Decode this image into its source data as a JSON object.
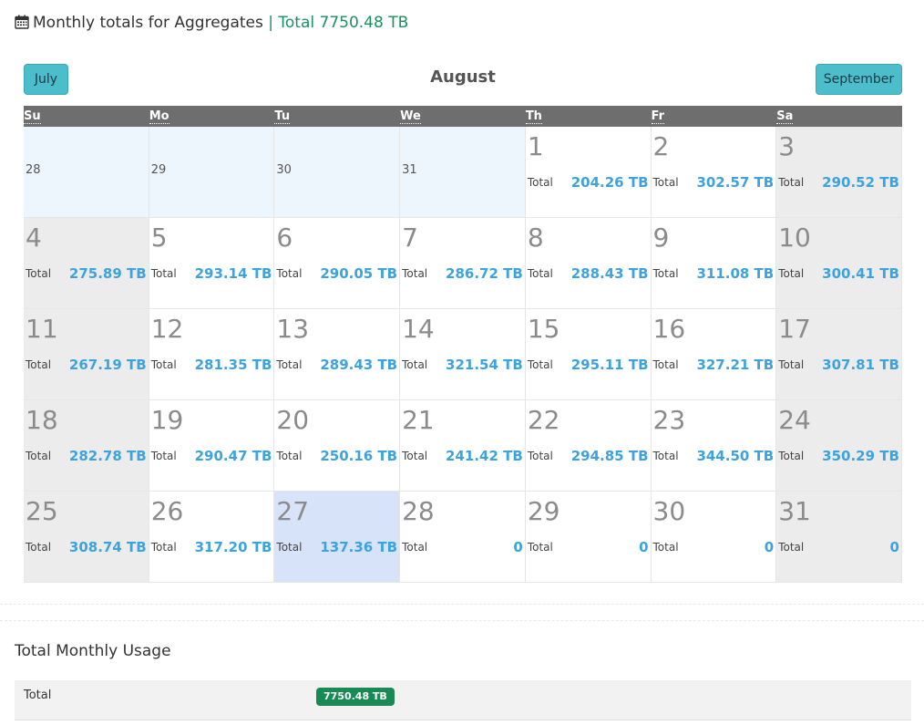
{
  "header": {
    "icon": "calendar-icon",
    "title": "Monthly totals for Aggregates",
    "separator": "|",
    "total_text": "Total 7750.48 TB",
    "accent_color": "#1a9160"
  },
  "nav": {
    "prev_label": "July",
    "month_label": "August",
    "next_label": "September",
    "button_color": "#4bbdcb"
  },
  "calendar": {
    "weekdays": [
      "Su",
      "Mo",
      "Tu",
      "We",
      "Th",
      "Fr",
      "Sa"
    ],
    "today": 27,
    "weeks": [
      [
        {
          "day": "28",
          "other": true
        },
        {
          "day": "29",
          "other": true
        },
        {
          "day": "30",
          "other": true
        },
        {
          "day": "31",
          "other": true
        },
        {
          "day": "1",
          "label": "Total",
          "value": "204.26 TB"
        },
        {
          "day": "2",
          "label": "Total",
          "value": "302.57 TB"
        },
        {
          "day": "3",
          "label": "Total",
          "value": "290.52 TB"
        }
      ],
      [
        {
          "day": "4",
          "label": "Total",
          "value": "275.89 TB"
        },
        {
          "day": "5",
          "label": "Total",
          "value": "293.14 TB"
        },
        {
          "day": "6",
          "label": "Total",
          "value": "290.05 TB"
        },
        {
          "day": "7",
          "label": "Total",
          "value": "286.72 TB"
        },
        {
          "day": "8",
          "label": "Total",
          "value": "288.43 TB"
        },
        {
          "day": "9",
          "label": "Total",
          "value": "311.08 TB"
        },
        {
          "day": "10",
          "label": "Total",
          "value": "300.41 TB"
        }
      ],
      [
        {
          "day": "11",
          "label": "Total",
          "value": "267.19 TB"
        },
        {
          "day": "12",
          "label": "Total",
          "value": "281.35 TB"
        },
        {
          "day": "13",
          "label": "Total",
          "value": "289.43 TB"
        },
        {
          "day": "14",
          "label": "Total",
          "value": "321.54 TB"
        },
        {
          "day": "15",
          "label": "Total",
          "value": "295.11 TB"
        },
        {
          "day": "16",
          "label": "Total",
          "value": "327.21 TB"
        },
        {
          "day": "17",
          "label": "Total",
          "value": "307.81 TB"
        }
      ],
      [
        {
          "day": "18",
          "label": "Total",
          "value": "282.78 TB"
        },
        {
          "day": "19",
          "label": "Total",
          "value": "290.47 TB"
        },
        {
          "day": "20",
          "label": "Total",
          "value": "250.16 TB"
        },
        {
          "day": "21",
          "label": "Total",
          "value": "241.42 TB"
        },
        {
          "day": "22",
          "label": "Total",
          "value": "294.85 TB"
        },
        {
          "day": "23",
          "label": "Total",
          "value": "344.50 TB"
        },
        {
          "day": "24",
          "label": "Total",
          "value": "350.29 TB"
        }
      ],
      [
        {
          "day": "25",
          "label": "Total",
          "value": "308.74 TB"
        },
        {
          "day": "26",
          "label": "Total",
          "value": "317.20 TB"
        },
        {
          "day": "27",
          "label": "Total",
          "value": "137.36 TB",
          "today": true
        },
        {
          "day": "28",
          "label": "Total",
          "value": "0"
        },
        {
          "day": "29",
          "label": "Total",
          "value": "0"
        },
        {
          "day": "30",
          "label": "Total",
          "value": "0"
        },
        {
          "day": "31",
          "label": "Total",
          "value": "0"
        }
      ]
    ]
  },
  "usage": {
    "title": "Total Monthly Usage",
    "row_label": "Total",
    "badge_value": "7750.48 TB",
    "badge_color": "#1a8a55"
  }
}
